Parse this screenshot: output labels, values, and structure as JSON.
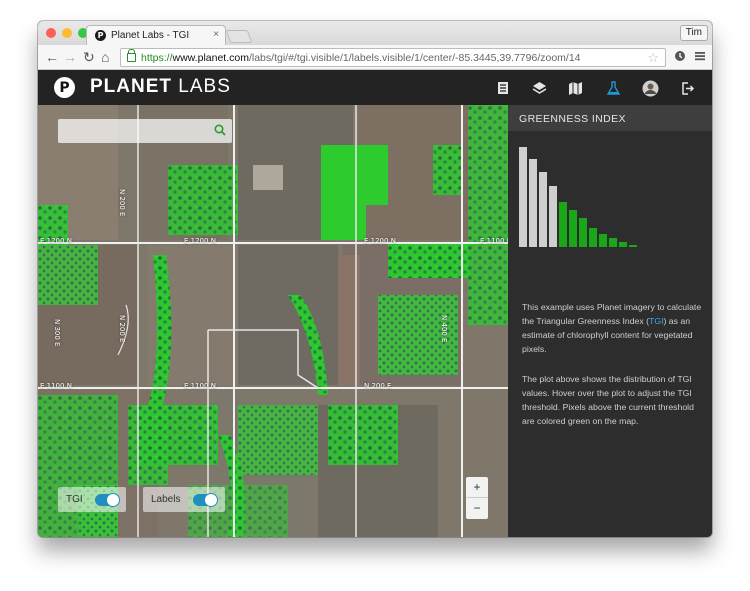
{
  "browser": {
    "tab_title": "Planet Labs - TGI",
    "tab_close": "×",
    "user": "Tim",
    "url": {
      "scheme": "https://",
      "host": "www.planet.com",
      "path": "/labs/tgi/#/tgi.visible/1/labels.visible/1/center/-85.3445,39.7796/zoom/14"
    },
    "nav_icons": [
      "back-icon",
      "forward-icon",
      "reload-icon",
      "home-icon"
    ]
  },
  "app": {
    "logo_letter": "P",
    "brand_bold": "PLANET",
    "brand_light": "LABS",
    "header_icons": [
      "document-icon",
      "layers-icon",
      "map-icon",
      "flask-icon",
      "avatar-icon",
      "logout-icon"
    ],
    "accent": "#1f9ad6"
  },
  "map": {
    "road_labels": [
      "E 1200 N",
      "E 1200 N",
      "E 1200 N",
      "E 1100 N",
      "E 1100 N",
      "E 1100 N",
      "N 200 E",
      "N 200 E",
      "N 200 E",
      "N 300 E",
      "N 400 E"
    ],
    "search_placeholder": "",
    "toggles": [
      {
        "label": "TGI",
        "on": true
      },
      {
        "label": "Labels",
        "on": true
      }
    ],
    "zoom_in": "+",
    "zoom_out": "−"
  },
  "panel": {
    "title": "GREENNESS INDEX",
    "histogram": {
      "values": [
        1.0,
        0.88,
        0.75,
        0.61,
        0.45,
        0.37,
        0.29,
        0.19,
        0.13,
        0.09,
        0.05,
        0.02
      ],
      "threshold_index": 4,
      "below_color": "#cfcfcf",
      "above_color": "#19a619"
    },
    "para1_prefix": "This example uses Planet imagery to calculate the Triangular Greenness Index (",
    "para1_link": "TGI",
    "para1_suffix": ") as an estimate of chlorophyll content for vegetated pixels.",
    "para2": "The plot above shows the distribution of TGI values. Hover over the plot to adjust the TGI threshold. Pixels above the current threshold are colored green on the map."
  }
}
